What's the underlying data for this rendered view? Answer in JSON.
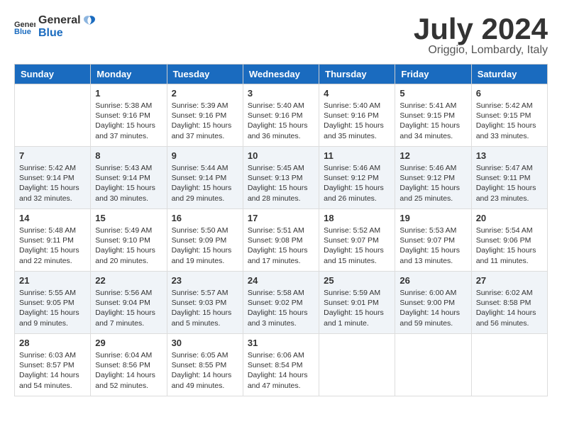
{
  "header": {
    "logo_general": "General",
    "logo_blue": "Blue",
    "month": "July 2024",
    "location": "Origgio, Lombardy, Italy"
  },
  "weekdays": [
    "Sunday",
    "Monday",
    "Tuesday",
    "Wednesday",
    "Thursday",
    "Friday",
    "Saturday"
  ],
  "weeks": [
    [
      {
        "day": "",
        "info": ""
      },
      {
        "day": "1",
        "info": "Sunrise: 5:38 AM\nSunset: 9:16 PM\nDaylight: 15 hours\nand 37 minutes."
      },
      {
        "day": "2",
        "info": "Sunrise: 5:39 AM\nSunset: 9:16 PM\nDaylight: 15 hours\nand 37 minutes."
      },
      {
        "day": "3",
        "info": "Sunrise: 5:40 AM\nSunset: 9:16 PM\nDaylight: 15 hours\nand 36 minutes."
      },
      {
        "day": "4",
        "info": "Sunrise: 5:40 AM\nSunset: 9:16 PM\nDaylight: 15 hours\nand 35 minutes."
      },
      {
        "day": "5",
        "info": "Sunrise: 5:41 AM\nSunset: 9:15 PM\nDaylight: 15 hours\nand 34 minutes."
      },
      {
        "day": "6",
        "info": "Sunrise: 5:42 AM\nSunset: 9:15 PM\nDaylight: 15 hours\nand 33 minutes."
      }
    ],
    [
      {
        "day": "7",
        "info": "Sunrise: 5:42 AM\nSunset: 9:14 PM\nDaylight: 15 hours\nand 32 minutes."
      },
      {
        "day": "8",
        "info": "Sunrise: 5:43 AM\nSunset: 9:14 PM\nDaylight: 15 hours\nand 30 minutes."
      },
      {
        "day": "9",
        "info": "Sunrise: 5:44 AM\nSunset: 9:14 PM\nDaylight: 15 hours\nand 29 minutes."
      },
      {
        "day": "10",
        "info": "Sunrise: 5:45 AM\nSunset: 9:13 PM\nDaylight: 15 hours\nand 28 minutes."
      },
      {
        "day": "11",
        "info": "Sunrise: 5:46 AM\nSunset: 9:12 PM\nDaylight: 15 hours\nand 26 minutes."
      },
      {
        "day": "12",
        "info": "Sunrise: 5:46 AM\nSunset: 9:12 PM\nDaylight: 15 hours\nand 25 minutes."
      },
      {
        "day": "13",
        "info": "Sunrise: 5:47 AM\nSunset: 9:11 PM\nDaylight: 15 hours\nand 23 minutes."
      }
    ],
    [
      {
        "day": "14",
        "info": "Sunrise: 5:48 AM\nSunset: 9:11 PM\nDaylight: 15 hours\nand 22 minutes."
      },
      {
        "day": "15",
        "info": "Sunrise: 5:49 AM\nSunset: 9:10 PM\nDaylight: 15 hours\nand 20 minutes."
      },
      {
        "day": "16",
        "info": "Sunrise: 5:50 AM\nSunset: 9:09 PM\nDaylight: 15 hours\nand 19 minutes."
      },
      {
        "day": "17",
        "info": "Sunrise: 5:51 AM\nSunset: 9:08 PM\nDaylight: 15 hours\nand 17 minutes."
      },
      {
        "day": "18",
        "info": "Sunrise: 5:52 AM\nSunset: 9:07 PM\nDaylight: 15 hours\nand 15 minutes."
      },
      {
        "day": "19",
        "info": "Sunrise: 5:53 AM\nSunset: 9:07 PM\nDaylight: 15 hours\nand 13 minutes."
      },
      {
        "day": "20",
        "info": "Sunrise: 5:54 AM\nSunset: 9:06 PM\nDaylight: 15 hours\nand 11 minutes."
      }
    ],
    [
      {
        "day": "21",
        "info": "Sunrise: 5:55 AM\nSunset: 9:05 PM\nDaylight: 15 hours\nand 9 minutes."
      },
      {
        "day": "22",
        "info": "Sunrise: 5:56 AM\nSunset: 9:04 PM\nDaylight: 15 hours\nand 7 minutes."
      },
      {
        "day": "23",
        "info": "Sunrise: 5:57 AM\nSunset: 9:03 PM\nDaylight: 15 hours\nand 5 minutes."
      },
      {
        "day": "24",
        "info": "Sunrise: 5:58 AM\nSunset: 9:02 PM\nDaylight: 15 hours\nand 3 minutes."
      },
      {
        "day": "25",
        "info": "Sunrise: 5:59 AM\nSunset: 9:01 PM\nDaylight: 15 hours\nand 1 minute."
      },
      {
        "day": "26",
        "info": "Sunrise: 6:00 AM\nSunset: 9:00 PM\nDaylight: 14 hours\nand 59 minutes."
      },
      {
        "day": "27",
        "info": "Sunrise: 6:02 AM\nSunset: 8:58 PM\nDaylight: 14 hours\nand 56 minutes."
      }
    ],
    [
      {
        "day": "28",
        "info": "Sunrise: 6:03 AM\nSunset: 8:57 PM\nDaylight: 14 hours\nand 54 minutes."
      },
      {
        "day": "29",
        "info": "Sunrise: 6:04 AM\nSunset: 8:56 PM\nDaylight: 14 hours\nand 52 minutes."
      },
      {
        "day": "30",
        "info": "Sunrise: 6:05 AM\nSunset: 8:55 PM\nDaylight: 14 hours\nand 49 minutes."
      },
      {
        "day": "31",
        "info": "Sunrise: 6:06 AM\nSunset: 8:54 PM\nDaylight: 14 hours\nand 47 minutes."
      },
      {
        "day": "",
        "info": ""
      },
      {
        "day": "",
        "info": ""
      },
      {
        "day": "",
        "info": ""
      }
    ]
  ]
}
